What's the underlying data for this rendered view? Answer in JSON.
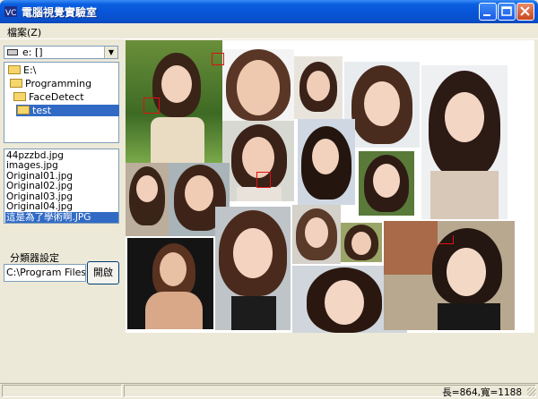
{
  "window": {
    "title": "電腦視覺實驗室"
  },
  "menu": {
    "file": "檔案(Z)"
  },
  "drive": {
    "label": "e: []"
  },
  "folders": [
    {
      "label": "E:\\"
    },
    {
      "label": "Programming"
    },
    {
      "label": "FaceDetect"
    },
    {
      "label": "test",
      "selected": true
    }
  ],
  "files": [
    {
      "label": "44pzzbd.jpg"
    },
    {
      "label": "images.jpg"
    },
    {
      "label": "Original01.jpg"
    },
    {
      "label": "Original02.jpg"
    },
    {
      "label": "Original03.jpg"
    },
    {
      "label": "Original04.jpg"
    },
    {
      "label": "這是為了學術啊.JPG",
      "selected": true
    }
  ],
  "classifier": {
    "label": "分類器設定",
    "path": "C:\\Program Files",
    "open_button": "開啟"
  },
  "status": {
    "dimensions": "長=864,寬=1188"
  },
  "colors": {
    "selection": "#316ac5",
    "detection_box": "#e01010",
    "titlebar": "#0753d6"
  },
  "icons": [
    "app-icon",
    "minimize-icon",
    "maximize-icon",
    "close-icon",
    "drive-icon",
    "folder-icon",
    "dropdown-arrow-icon",
    "resize-grip-icon"
  ]
}
